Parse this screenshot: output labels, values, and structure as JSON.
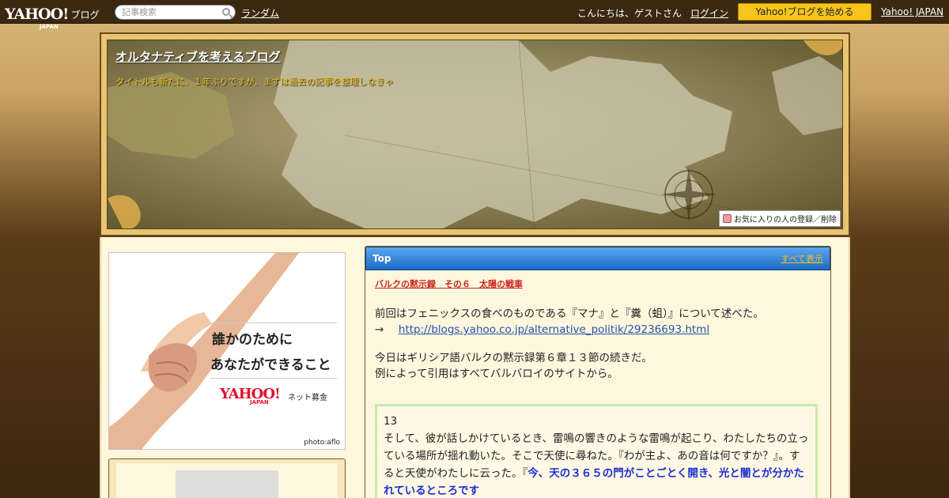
{
  "topbar": {
    "logo_main": "YAHOO!",
    "logo_japan": "JAPAN",
    "logo_sub": "ブログ",
    "search_placeholder": "記事検索",
    "random": "ランダム",
    "greeting": "こんにちは、ゲストさん",
    "login": "ログイン",
    "start_blog": "Yahoo!ブログを始める",
    "yahoo_japan": "Yahoo! JAPAN"
  },
  "header": {
    "title": "オルタナティブを考えるブログ",
    "description": "タイトルも新たに、１年ぶりですが、まずは過去の記事を整理しなきゃ",
    "favorite_button": "お気に入りの人の登録／削除"
  },
  "ad": {
    "line1": "誰かのために",
    "line2": "あなたができること",
    "logo": "YAHOO!",
    "logo_japan": "JAPAN",
    "logo_sub": "ネット募金",
    "credit": "photo:aflo"
  },
  "content": {
    "head_title": "Top",
    "show_all": "すべて表示",
    "post_title": "バルクの黙示録　その６　太陽の戦車",
    "para1": "前回はフェニックスの食べのものである『マナ』と『糞（蛆）』について述べた。",
    "arrow": "→",
    "link": "http://blogs.yahoo.co.jp/alternative_politik/29236693.html",
    "para2": "今日はギリシア語バルクの黙示録第６章１３節の続きだ。",
    "para3": "例によって引用はすべてバルバロイのサイトから。",
    "verse": "13",
    "quote_text": "そして、彼が話しかけているとき、雷鳴の響きのような雷鳴が起こり、わたしたちの立っている場所が揺れ動いた。そこで天使に尋ねた。『わが主よ、あの音は何ですか？』。すると天使がわたしに云った。『",
    "quote_highlight": "今、天の３６５の門がことごとく開き、光と闇とが分かたれているところです"
  }
}
